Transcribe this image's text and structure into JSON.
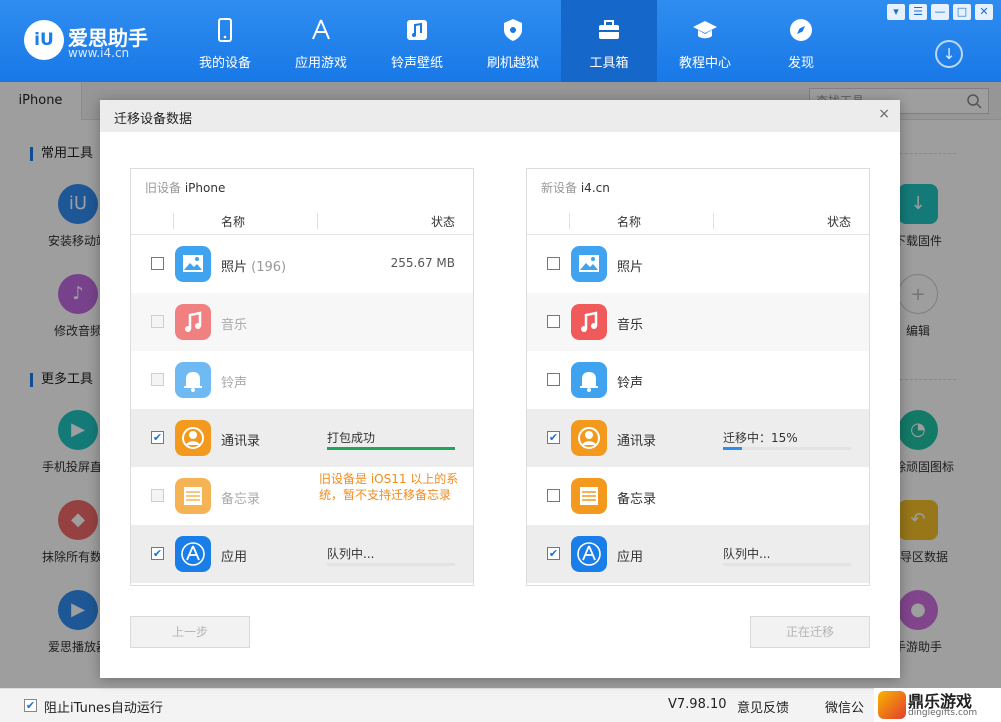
{
  "app": {
    "brand_name": "爱思助手",
    "brand_url": "www.i4.cn",
    "logo_text": "iU"
  },
  "nav": [
    {
      "label": "我的设备",
      "icon": "phone-icon"
    },
    {
      "label": "应用游戏",
      "icon": "app-store-icon"
    },
    {
      "label": "铃声壁纸",
      "icon": "music-icon"
    },
    {
      "label": "刷机越狱",
      "icon": "shield-icon"
    },
    {
      "label": "工具箱",
      "icon": "toolbox-icon",
      "active": true
    },
    {
      "label": "教程中心",
      "icon": "graduation-cap-icon"
    },
    {
      "label": "发现",
      "icon": "compass-icon"
    }
  ],
  "window_controls": [
    "▾",
    "☰",
    "—",
    "□",
    "✕"
  ],
  "background": {
    "tab_label": "iPhone",
    "search_placeholder": "查找工具",
    "sections": [
      "常用工具",
      "更多工具"
    ],
    "tools_left": [
      "安装移动端",
      "修改音频",
      "手机投屏直播",
      "抹除所有数据",
      "爱思播放器"
    ],
    "tools_right": [
      "下载固件",
      "编辑",
      "删除顽固图标",
      "引导区数据",
      "手游助手"
    ]
  },
  "statusbar": {
    "itunes_label": "阻止iTunes自动运行",
    "version": "V7.98.10",
    "feedback": "意见反馈",
    "wechat": "微信公"
  },
  "watermark": {
    "title": "鼎乐游戏",
    "url": "dinglegifts.com"
  },
  "modal": {
    "title": "迁移设备数据",
    "close": "×",
    "left": {
      "title_prefix": "旧设备",
      "title_device": "iPhone",
      "col_name": "名称",
      "col_status": "状态",
      "rows": [
        {
          "name": "照片",
          "count": "(196)",
          "size": "255.67 MB"
        },
        {
          "name": "音乐"
        },
        {
          "name": "铃声"
        },
        {
          "name": "通讯录",
          "status": "打包成功",
          "progress": 1.0
        },
        {
          "name": "备忘录",
          "warning": "旧设备是 iOS11 以上的系统，暂不支持迁移备忘录"
        },
        {
          "name": "应用",
          "status": "队列中...",
          "progress": 0
        }
      ]
    },
    "right": {
      "title_prefix": "新设备",
      "title_device": "i4.cn",
      "col_name": "名称",
      "col_status": "状态",
      "rows": [
        {
          "name": "照片"
        },
        {
          "name": "音乐"
        },
        {
          "name": "铃声"
        },
        {
          "name": "通讯录",
          "status": "迁移中：15%",
          "progress": 0.15
        },
        {
          "name": "备忘录"
        },
        {
          "name": "应用",
          "status": "队列中...",
          "progress": 0
        }
      ]
    },
    "prev_button": "上一步",
    "next_button": "正在迁移"
  }
}
